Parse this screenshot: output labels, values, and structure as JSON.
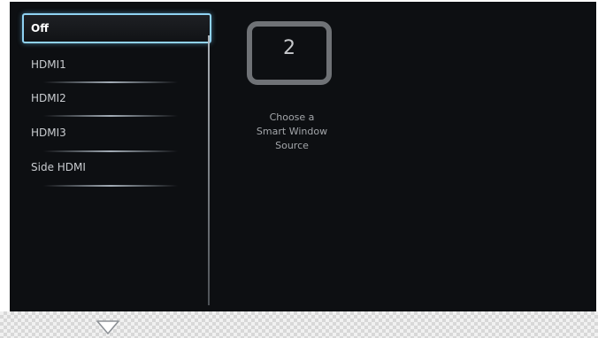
{
  "menu": {
    "items": [
      {
        "label": "Off",
        "selected": true
      },
      {
        "label": "HDMI1",
        "selected": false
      },
      {
        "label": "HDMI2",
        "selected": false
      },
      {
        "label": "HDMI3",
        "selected": false
      },
      {
        "label": "Side HDMI",
        "selected": false
      }
    ]
  },
  "preview": {
    "window_number": "2",
    "hint_lines": [
      "Choose a",
      "Smart Window",
      "Source"
    ]
  },
  "footer": {
    "scroll_icon": "triangle-down-outline"
  },
  "colors": {
    "panel_background": "#0d0f12",
    "highlight_border": "#8fd2f2",
    "menu_text": "#c9ccd0",
    "icon_frame": "#6f7276"
  }
}
